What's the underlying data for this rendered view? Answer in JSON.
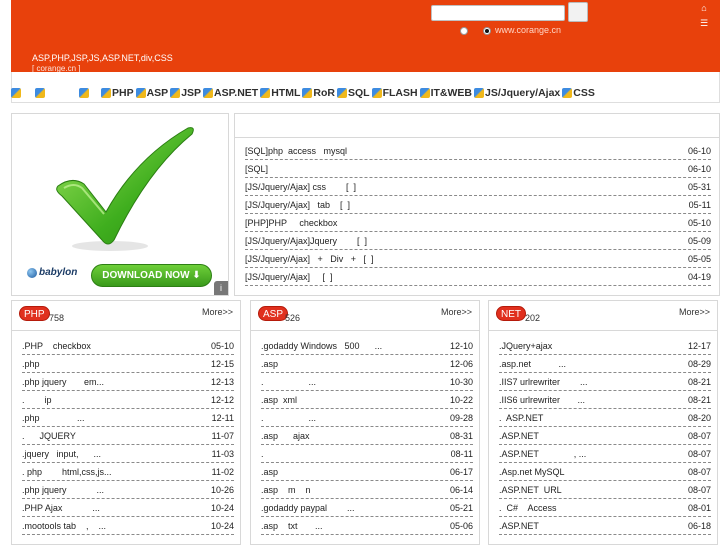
{
  "header": {
    "keywords": "ASP,PHP,JSP,JS,ASP.NET,div,CSS",
    "site_url": "[ corange.cn ]",
    "radio_label": "www.corange.cn",
    "search_value": ""
  },
  "nav": {
    "items": [
      "PHP",
      "ASP",
      "JSP",
      "ASP.NET",
      "HTML",
      "RoR",
      "SQL",
      "FLASH",
      "IT&WEB",
      "JS/Jquery/Ajax",
      "CSS"
    ]
  },
  "ad": {
    "brand": "babylon",
    "cta": "DOWNLOAD NOW"
  },
  "latest": {
    "rows": [
      {
        "title": "[SQL]php  access   mysql",
        "date": "06-10"
      },
      {
        "title": "[SQL]",
        "date": "06-10"
      },
      {
        "title": "[JS/Jquery/Ajax] css        [  ]",
        "date": "05-31"
      },
      {
        "title": "[JS/Jquery/Ajax]   tab    [  ]",
        "date": "05-11"
      },
      {
        "title": "[PHP]PHP     checkbox",
        "date": "05-10"
      },
      {
        "title": "[JS/Jquery/Ajax]Jquery        [  ]",
        "date": "05-09"
      },
      {
        "title": "[JS/Jquery/Ajax]   +   Div   +   [  ]",
        "date": "05-05"
      },
      {
        "title": "[JS/Jquery/Ajax]     [  ]",
        "date": "04-19"
      }
    ]
  },
  "sections": [
    {
      "badge": "PHP",
      "count": "758",
      "more": "More>>",
      "rows": [
        {
          "title": ".PHP    checkbox",
          "date": "05-10"
        },
        {
          "title": ".php",
          "date": "12-15"
        },
        {
          "title": ".php jquery       em...",
          "date": "12-13"
        },
        {
          "title": ".        ip",
          "date": "12-12"
        },
        {
          "title": ".php               ...",
          "date": "12-11"
        },
        {
          "title": ".      JQUERY",
          "date": "11-07"
        },
        {
          "title": ".jquery   input,      ...",
          "date": "11-03"
        },
        {
          "title": ". php        html,css,js...",
          "date": "11-02"
        },
        {
          "title": ".php jquery            ...",
          "date": "10-26"
        },
        {
          "title": ".PHP Ajax            ...",
          "date": "10-24"
        },
        {
          "title": ".mootools tab    ,    ...",
          "date": "10-24"
        }
      ]
    },
    {
      "badge": "ASP",
      "count": "526",
      "more": "More>>",
      "rows": [
        {
          "title": ".godaddy Windows   500      ...",
          "date": "12-10"
        },
        {
          "title": ".asp",
          "date": "12-06"
        },
        {
          "title": ".                  ...",
          "date": "10-30"
        },
        {
          "title": ".asp  xml",
          "date": "10-22"
        },
        {
          "title": ".                  ...",
          "date": "09-28"
        },
        {
          "title": ".asp      ajax",
          "date": "08-31"
        },
        {
          "title": ".",
          "date": "08-11"
        },
        {
          "title": ".asp",
          "date": "06-17"
        },
        {
          "title": ".asp    m    n",
          "date": "06-14"
        },
        {
          "title": ".godaddy paypal        ...",
          "date": "05-21"
        },
        {
          "title": ".asp    txt       ...",
          "date": "05-06"
        }
      ]
    },
    {
      "badge": "NET",
      "count": "202",
      "more": "More>>",
      "rows": [
        {
          "title": ".JQuery+ajax",
          "date": "12-17"
        },
        {
          "title": ".asp.net           ...",
          "date": "08-29"
        },
        {
          "title": ".IIS7 urlrewriter        ...",
          "date": "08-21"
        },
        {
          "title": ".IIS6 urlrewriter       ...",
          "date": "08-21"
        },
        {
          "title": ".  ASP.NET",
          "date": "08-20"
        },
        {
          "title": ".ASP.NET",
          "date": "08-07"
        },
        {
          "title": ".ASP.NET              , ...",
          "date": "08-07"
        },
        {
          "title": ".Asp.net MySQL",
          "date": "08-07"
        },
        {
          "title": ".ASP.NET  URL",
          "date": "08-07"
        },
        {
          "title": ".  C#    Access",
          "date": "08-01"
        },
        {
          "title": ".ASP.NET",
          "date": "06-18"
        }
      ]
    }
  ],
  "colors": {
    "header_bg": "#e8410c",
    "badge_bg": "#e0301e",
    "cta_green": "#4fb52a"
  },
  "icons": {
    "home": "home-icon",
    "favorite": "favorite-icon",
    "nav": "category-icon",
    "ad_check": "green-check-icon",
    "ad_info": "ad-info-icon"
  }
}
